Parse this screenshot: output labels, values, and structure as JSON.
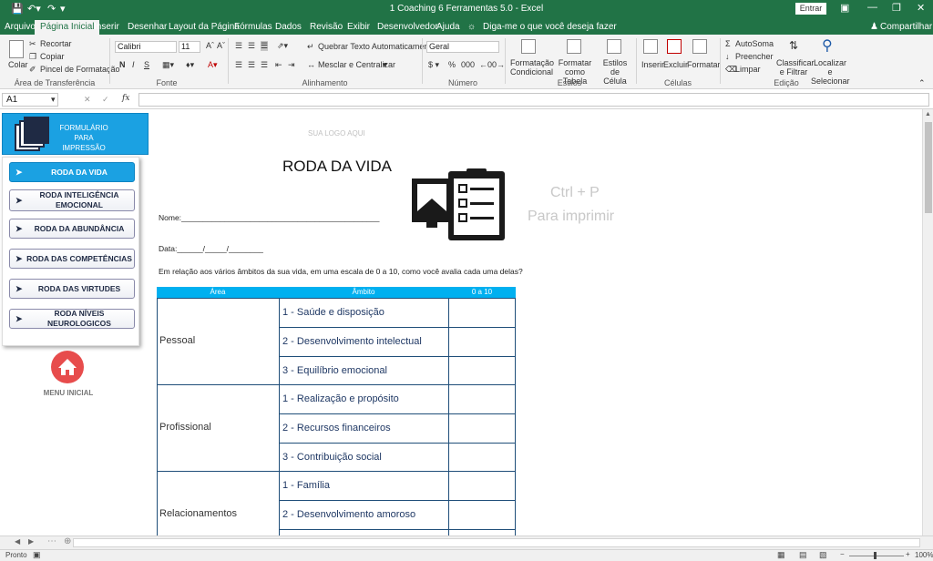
{
  "window": {
    "title": "1 Coaching 6 Ferramentas 5.0  -  Excel",
    "signin_label": "Entrar",
    "share_label": "Compartilhar",
    "search_placeholder": "Diga-me o que você deseja fazer"
  },
  "ribbon_tabs": [
    "Arquivo",
    "Página Inicial",
    "Inserir",
    "Desenhar",
    "Layout da Página",
    "Fórmulas",
    "Dados",
    "Revisão",
    "Exibir",
    "Desenvolvedor",
    "Ajuda"
  ],
  "ribbon": {
    "clipboard": {
      "paste": "Colar",
      "cut": "Recortar",
      "copy": "Copiar",
      "format_painter": "Pincel de Formatação",
      "group": "Área de Transferência"
    },
    "font": {
      "name": "Calibri",
      "size": "11",
      "bold": "N",
      "italic": "I",
      "underline": "S",
      "group": "Fonte"
    },
    "alignment": {
      "wrap": "Quebrar Texto Automaticamente",
      "merge": "Mesclar e Centralizar",
      "group": "Alinhamento"
    },
    "number": {
      "format": "Geral",
      "group": "Número"
    },
    "styles": {
      "conditional": "Formatação Condicional",
      "as_table": "Formatar como Tabela",
      "cell_styles": "Estilos de Célula",
      "group": "Estilos"
    },
    "cells": {
      "insert": "Inserir",
      "delete": "Excluir",
      "format": "Formatar",
      "group": "Células"
    },
    "editing": {
      "autosum": "AutoSoma",
      "fill": "Preencher",
      "clear": "Limpar",
      "sort_filter": "Classificar e Filtrar",
      "find_select": "Localizar e Selecionar",
      "group": "Edição"
    }
  },
  "formula_bar": {
    "name_box": "A1",
    "fx": "fx"
  },
  "sheet": {
    "header_title": "FORMULÁRIO PARA IMPRESSÃO",
    "logo_placeholder": "SUA LOGO AQUI",
    "print_hint_line1": "Ctrl + P",
    "print_hint_line2": "Para imprimir",
    "menu": [
      "RODA DA VIDA",
      "RODA INTELIGÊNCIA EMOCIONAL",
      "RODA DA ABUNDÂNCIA",
      "RODA DAS COMPETÊNCIAS",
      "RODA DAS VIRTUDES",
      "RODA NÍVEIS NEUROLOGICOS"
    ],
    "home_label": "MENU INICIAL",
    "form": {
      "title": "RODA DA VIDA",
      "name_line": "Nome:______________________________________________",
      "date_line": "Data:______/_____/________",
      "question": "Em relação aos vários âmbitos da sua vida, em uma escala de 0 a 10, como você avalia cada uma delas?",
      "columns": [
        "Área",
        "Âmbito",
        "0 a 10"
      ],
      "areas": [
        {
          "area": "Pessoal",
          "items": [
            "1 - Saúde e disposição",
            "2 - Desenvolvimento intelectual",
            "3 - Equilíbrio emocional"
          ]
        },
        {
          "area": "Profissional",
          "items": [
            "1 - Realização e propósito",
            "2 - Recursos financeiros",
            "3 - Contribuição social"
          ]
        },
        {
          "area": "Relacionamentos",
          "items": [
            "1 - Família",
            "2 - Desenvolvimento amoroso"
          ]
        }
      ]
    }
  },
  "status": {
    "ready": "Pronto",
    "zoom": "100%"
  },
  "colors": {
    "excel_green": "#217346",
    "accent_blue": "#1ba1e2",
    "header_blue": "#00b0f0",
    "home_red": "#e74c4c"
  }
}
